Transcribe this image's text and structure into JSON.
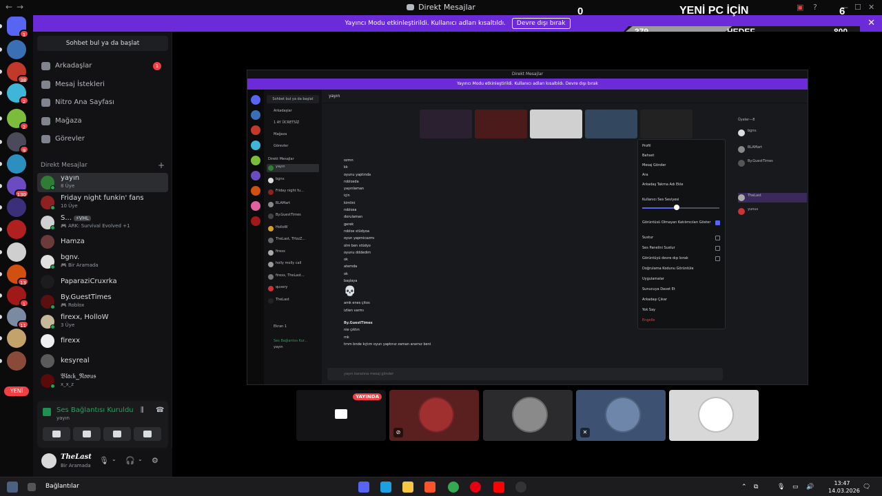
{
  "window": {
    "title": "Direkt Mesajlar",
    "nav": "←→"
  },
  "overlay": {
    "left_score": "0",
    "goal_title": "YENİ PC İÇİN",
    "right_score": "6",
    "current": "379",
    "goal_label": "HEDEF",
    "target": "800",
    "progress_fraction": 0.47
  },
  "banner": {
    "text": "Yayıncı Modu etkinleştirildi. Kullanıcı adları kısaltıldı.",
    "button": "Devre dışı bırak"
  },
  "rail": {
    "badges": [
      "1",
      "",
      "38",
      "2",
      "2",
      "9",
      "",
      "130",
      "",
      "",
      "",
      "13",
      "1",
      "11",
      "",
      ""
    ],
    "new_label": "YENİ"
  },
  "dm": {
    "search_placeholder": "Sohbet bul ya da başlat",
    "nav": [
      {
        "label": "Arkadaşlar",
        "icon": "friends-icon",
        "count": "1"
      },
      {
        "label": "Mesaj İstekleri",
        "icon": "mail-icon"
      },
      {
        "label": "Nitro Ana Sayfası",
        "icon": "nitro-icon"
      },
      {
        "label": "Mağaza",
        "icon": "shop-icon"
      },
      {
        "label": "Görevler",
        "icon": "quest-icon"
      }
    ],
    "section": "Direkt Mesajlar",
    "conversations": [
      {
        "name": "yayın",
        "sub": "8 Üye",
        "active": true
      },
      {
        "name": "Friday night funkin' fans",
        "sub": "10 Üye"
      },
      {
        "name": "S...",
        "tag": "⚡VHL",
        "sub": "🎮 ARK: Survival Evolved +1"
      },
      {
        "name": "Hamza"
      },
      {
        "name": "bgnv.",
        "sub": "🎮 Bir Aramada"
      },
      {
        "name": "PaparaziCruxrka"
      },
      {
        "name": "By.GuestTimes",
        "sub": "🎮 Roblox"
      },
      {
        "name": "firexx, HolloW",
        "sub": "3 Üye"
      },
      {
        "name": "firexx"
      },
      {
        "name": "kesyreal"
      },
      {
        "name": "𝔅𝔩𝔞𝔠𝔨_𝔑𝔬𝔳𝔲𝔰",
        "sub": "x_x_z"
      }
    ]
  },
  "voice": {
    "status": "Ses Bağlantısı Kuruldu",
    "channel": "yayın"
  },
  "user": {
    "name": "TheLast",
    "status": "Bir Aramada"
  },
  "screen": {
    "title": "Direkt Mesajlar",
    "banner": "Yayıncı Modu etkinleştirildi. Kullanıcı adları kısaltıldı.  Devre dışı bırak",
    "dm_search": "Sohbet bul ya da başlat",
    "dm_nav": [
      "Arkadaşlar",
      "1 AY ÜCRETSİZ",
      "Mağaza",
      "Görevler"
    ],
    "dm_section": "Direkt Mesajlar",
    "dm_list": [
      "yayın",
      "bgnv.",
      "Friday night fu...",
      "BLAMart",
      "By.GuestTimes",
      "HolloW",
      "TheLast, THzzZ...",
      "firexx",
      "holly molly call",
      "firexx, TheLast...",
      "quvery",
      "TheLast"
    ],
    "panel": [
      "Ekran 1",
      "Ses Bağlantısı Kur...",
      "yayın"
    ],
    "header": "yayın",
    "messages": [
      "ozmn",
      "kk",
      "oyunu yaptında",
      "robloxda",
      "yayınlaman",
      "için",
      "kimlini",
      "robloxa",
      "dorulaman",
      "gerek",
      "roblox stüdyoa",
      "oyun yapmicazmı",
      "olm ben stüdyo",
      "oyunu dddedim",
      "ok",
      "atemda",
      "ok",
      "başlaya",
      "💀",
      "amk enes çitos",
      "izlien varmı",
      "By.GuestTimes",
      "nie çıktın",
      "mk",
      "tmm bnde kçtım oyun yaptınız zaman ararnız beni"
    ],
    "menu": [
      "Profil",
      "Bahset",
      "Mesaj Gönder",
      "Ara",
      "Arkadaş Takma Adı Ekle",
      "Kullanıcı Ses Seviyesi",
      "Görüntüsü Olmayan Katılımcıları Göster",
      "Sustur",
      "Ses Panelini Sustur",
      "Görüntüyü devre dışı bırak",
      "Doğrulama Kodunu Görüntüle",
      "Uygulamalar",
      "Sunucuya Davet Et",
      "Arkadaşı Çıkar",
      "Yok Say",
      "Engelle"
    ],
    "members_title": "Üyeler—8",
    "members": [
      "bgnv.",
      "BLAMart",
      "By.GuestTimes",
      "TheLast",
      "yunus"
    ],
    "input": "yayın kanalına mesaj gönder"
  },
  "tiles": [
    {
      "name": "screen-share",
      "live": "YAYINDA",
      "color": "#141416"
    },
    {
      "name": "user-2",
      "color": "#5a1f1f"
    },
    {
      "name": "user-3",
      "color": "#2b2b2d"
    },
    {
      "name": "user-4",
      "color": "#3d5273"
    },
    {
      "name": "user-5",
      "color": "#d8d8d8"
    }
  ],
  "taskbar": {
    "label": "Bağlantılar",
    "time": "13:47",
    "date": "14.03.2026"
  }
}
